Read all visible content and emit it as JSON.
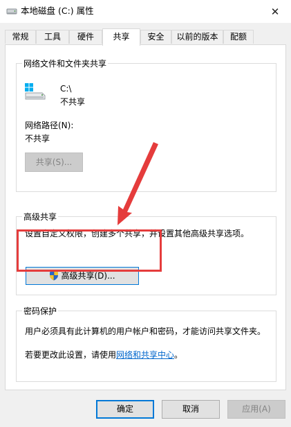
{
  "window": {
    "title": "本地磁盘 (C:) 属性",
    "close_glyph": "✕"
  },
  "tabs": [
    {
      "label": "常规"
    },
    {
      "label": "工具"
    },
    {
      "label": "硬件"
    },
    {
      "label": "共享"
    },
    {
      "label": "安全"
    },
    {
      "label": "以前的版本"
    },
    {
      "label": "配额"
    }
  ],
  "network_share": {
    "legend": "网络文件和文件夹共享",
    "drive": "C:\\",
    "status": "不共享",
    "path_label": "网络路径(N):",
    "path_value": "不共享",
    "share_button": "共享(S)..."
  },
  "advanced_share": {
    "legend": "高级共享",
    "description": "设置自定义权限，创建多个共享，并设置其他高级共享选项。",
    "button": "高级共享(D)..."
  },
  "password": {
    "legend": "密码保护",
    "text1": "用户必须具有此计算机的用户帐户和密码，才能访问共享文件夹。",
    "text2_prefix": "若要更改此设置，请使用",
    "link": "网络和共享中心",
    "text2_suffix": "。"
  },
  "footer": {
    "ok": "确定",
    "cancel": "取消",
    "apply": "应用(A)"
  },
  "colors": {
    "highlight": "#e53c3c",
    "link": "#0066cc",
    "focus": "#0078d7"
  }
}
